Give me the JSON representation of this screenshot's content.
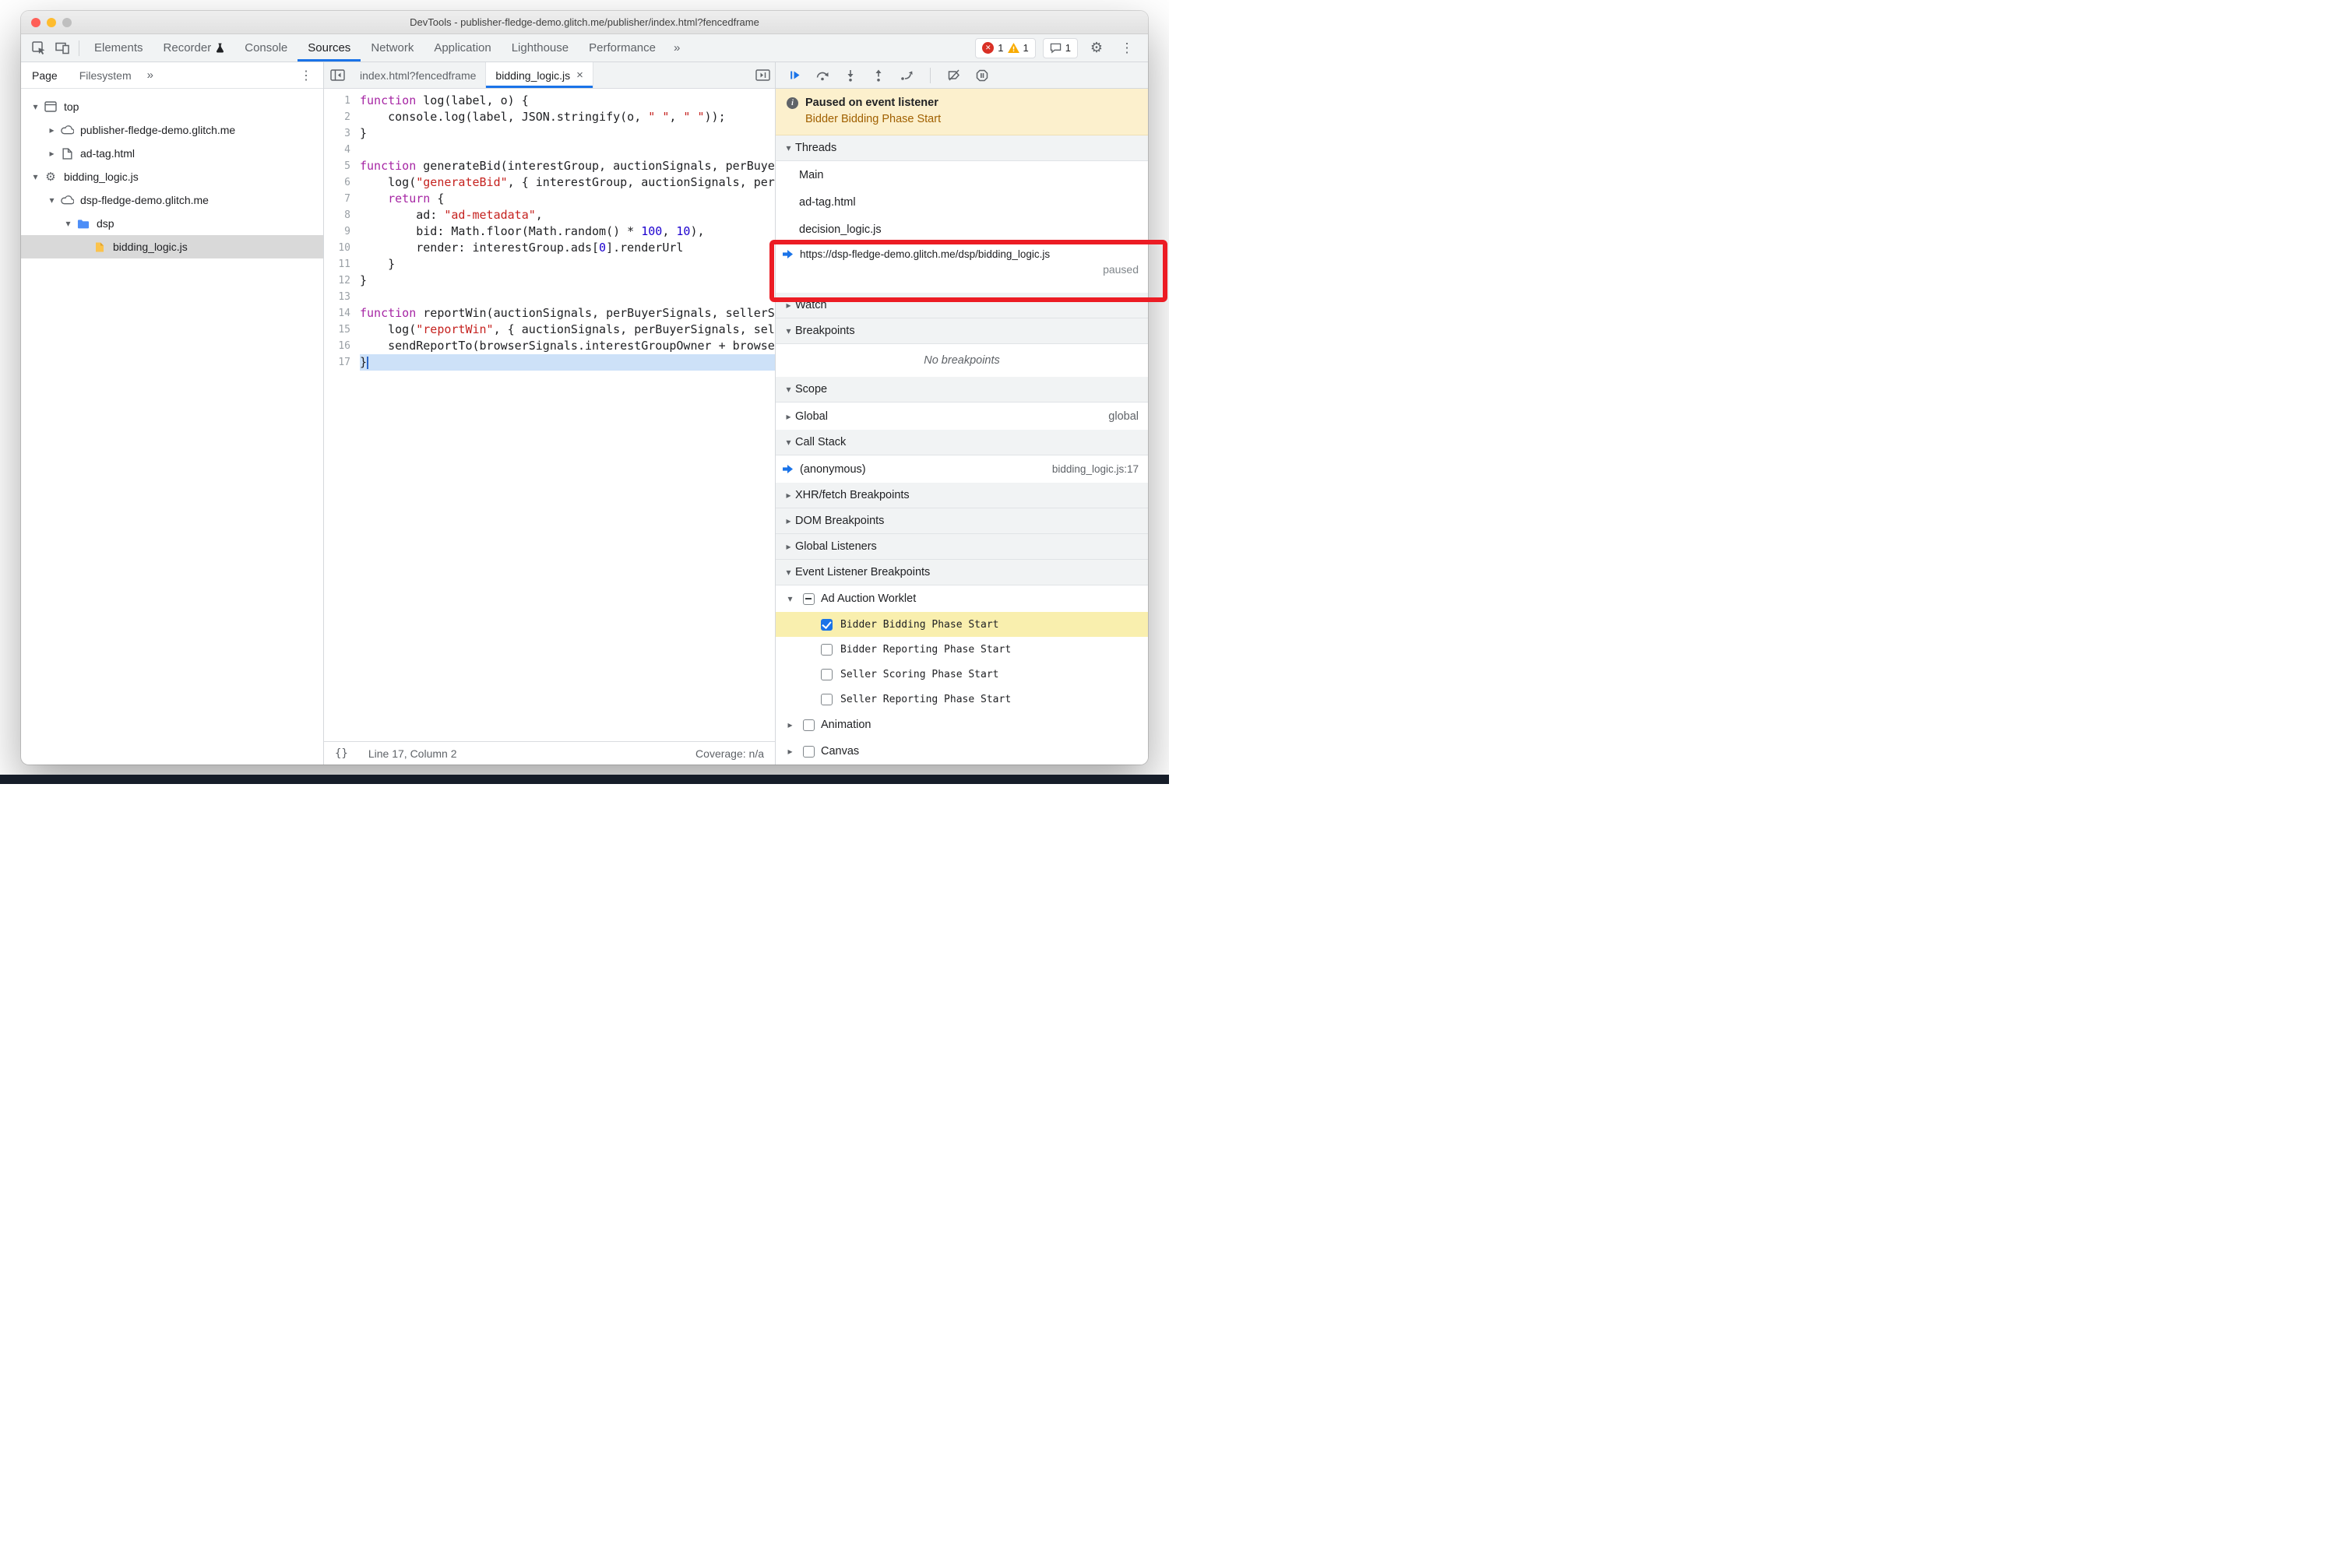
{
  "glyphs": {
    "expanded": "▾",
    "collapsed": "▸",
    "kebab": "⋮",
    "gear": "⚙",
    "close": "×",
    "pretty": "{}",
    "more": "»",
    "info": "i",
    "error": "✕"
  },
  "colors": {
    "accent": "#1a73e8",
    "annotation_red": "#ec1c24",
    "execution_line": "#cde1f8",
    "banner_bg": "#fcf0cd",
    "highlight_row": "#f9efae"
  },
  "window": {
    "title": "DevTools - publisher-fledge-demo.glitch.me/publisher/index.html?fencedframe"
  },
  "toolbar": {
    "tabs": [
      {
        "label": "Elements",
        "active": false
      },
      {
        "label": "Recorder",
        "active": false,
        "flask": true
      },
      {
        "label": "Console",
        "active": false
      },
      {
        "label": "Sources",
        "active": true
      },
      {
        "label": "Network",
        "active": false
      },
      {
        "label": "Application",
        "active": false
      },
      {
        "label": "Lighthouse",
        "active": false
      },
      {
        "label": "Performance",
        "active": false
      }
    ],
    "more_tabs": "»",
    "error_count": "1",
    "warning_count": "1",
    "message_count": "1"
  },
  "navigator": {
    "tabs": {
      "page": "Page",
      "filesystem": "Filesystem",
      "more": "»"
    },
    "tree": [
      {
        "label": "top",
        "icon": "frame",
        "arrow": "expanded",
        "indent": 0
      },
      {
        "label": "publisher-fledge-demo.glitch.me",
        "icon": "cloud",
        "arrow": "collapsed",
        "indent": 1
      },
      {
        "label": "ad-tag.html",
        "icon": "document",
        "arrow": "collapsed",
        "indent": 1
      },
      {
        "label": "bidding_logic.js",
        "icon": "worklet",
        "arrow": "expanded",
        "indent": 0
      },
      {
        "label": "dsp-fledge-demo.glitch.me",
        "icon": "cloud",
        "arrow": "expanded",
        "indent": 1
      },
      {
        "label": "dsp",
        "icon": "folder",
        "arrow": "expanded",
        "indent": 2
      },
      {
        "label": "bidding_logic.js",
        "icon": "file",
        "arrow": "none",
        "indent": 3,
        "selected": true
      }
    ]
  },
  "editor": {
    "tabs": [
      {
        "label": "index.html?fencedframe",
        "active": false
      },
      {
        "label": "bidding_logic.js",
        "active": true,
        "closable": true
      }
    ],
    "lines": [
      {
        "n": 1,
        "tokens": [
          [
            "kw",
            "function"
          ],
          [
            "pl",
            " log(label, o) {"
          ]
        ]
      },
      {
        "n": 2,
        "tokens": [
          [
            "pl",
            "    console.log(label, JSON.stringify(o, "
          ],
          [
            "str",
            "\" \""
          ],
          [
            "pl",
            ", "
          ],
          [
            "str",
            "\" \""
          ],
          [
            "pl",
            "));"
          ]
        ]
      },
      {
        "n": 3,
        "tokens": [
          [
            "pl",
            "}"
          ]
        ]
      },
      {
        "n": 4,
        "tokens": []
      },
      {
        "n": 5,
        "tokens": [
          [
            "kw",
            "function"
          ],
          [
            "pl",
            " generateBid(interestGroup, auctionSignals, perBuyerSignals, trustedBiddingSignals, browserSignals) {"
          ]
        ]
      },
      {
        "n": 6,
        "tokens": [
          [
            "pl",
            "    log("
          ],
          [
            "str",
            "\"generateBid\""
          ],
          [
            "pl",
            ", { interestGroup, auctionSignals, perBuyerSignals, trustedBiddingSignals });"
          ]
        ]
      },
      {
        "n": 7,
        "tokens": [
          [
            "pl",
            "    "
          ],
          [
            "kw",
            "return"
          ],
          [
            "pl",
            " {"
          ]
        ]
      },
      {
        "n": 8,
        "tokens": [
          [
            "pl",
            "        ad: "
          ],
          [
            "str",
            "\"ad-metadata\""
          ],
          [
            "pl",
            ","
          ]
        ]
      },
      {
        "n": 9,
        "tokens": [
          [
            "pl",
            "        bid: Math.floor(Math.random() * "
          ],
          [
            "num",
            "100"
          ],
          [
            "pl",
            ", "
          ],
          [
            "num",
            "10"
          ],
          [
            "pl",
            "),"
          ]
        ]
      },
      {
        "n": 10,
        "tokens": [
          [
            "pl",
            "        render: interestGroup.ads["
          ],
          [
            "num",
            "0"
          ],
          [
            "pl",
            "].renderUrl"
          ]
        ]
      },
      {
        "n": 11,
        "tokens": [
          [
            "pl",
            "    }"
          ]
        ]
      },
      {
        "n": 12,
        "tokens": [
          [
            "pl",
            "}"
          ]
        ]
      },
      {
        "n": 13,
        "tokens": []
      },
      {
        "n": 14,
        "tokens": [
          [
            "kw",
            "function"
          ],
          [
            "pl",
            " reportWin(auctionSignals, perBuyerSignals, sellerSignals, browserSignals) {"
          ]
        ]
      },
      {
        "n": 15,
        "tokens": [
          [
            "pl",
            "    log("
          ],
          [
            "str",
            "\"reportWin\""
          ],
          [
            "pl",
            ", { auctionSignals, perBuyerSignals, sellerSignals, browserSignals });"
          ]
        ]
      },
      {
        "n": 16,
        "tokens": [
          [
            "pl",
            "    sendReportTo(browserSignals.interestGroupOwner + browserSignals.topWindowHostname);"
          ]
        ]
      },
      {
        "n": 17,
        "tokens": [
          [
            "pl",
            "}"
          ]
        ],
        "hl": true
      }
    ],
    "status": {
      "line_col": "Line 17, Column 2",
      "coverage": "Coverage: n/a"
    }
  },
  "debugger": {
    "banner": {
      "title": "Paused on event listener",
      "subtitle": "Bidder Bidding Phase Start"
    },
    "threads": {
      "title": "Threads",
      "items": [
        {
          "label": "Main"
        },
        {
          "label": "ad-tag.html"
        },
        {
          "label": "decision_logic.js"
        },
        {
          "label": "https://dsp-fledge-demo.glitch.me/dsp/bidding_logic.js",
          "active": true,
          "status": "paused"
        }
      ]
    },
    "watch": {
      "title": "Watch"
    },
    "breakpoints": {
      "title": "Breakpoints",
      "empty": "No breakpoints"
    },
    "scope": {
      "title": "Scope",
      "rows": [
        {
          "label": "Global",
          "value": "global"
        }
      ]
    },
    "call_stack": {
      "title": "Call Stack",
      "frames": [
        {
          "label": "(anonymous)",
          "location": "bidding_logic.js:17",
          "active": true
        }
      ]
    },
    "xhr_breakpoints": {
      "title": "XHR/fetch Breakpoints"
    },
    "dom_breakpoints": {
      "title": "DOM Breakpoints"
    },
    "global_listeners": {
      "title": "Global Listeners"
    },
    "event_listener_breakpoints": {
      "title": "Event Listener Breakpoints",
      "categories": [
        {
          "label": "Ad Auction Worklet",
          "state": "indeterminate",
          "expanded": true,
          "events": [
            {
              "label": "Bidder Bidding Phase Start",
              "checked": true,
              "highlight": true
            },
            {
              "label": "Bidder Reporting Phase Start",
              "checked": false
            },
            {
              "label": "Seller Scoring Phase Start",
              "checked": false
            },
            {
              "label": "Seller Reporting Phase Start",
              "checked": false
            }
          ]
        },
        {
          "label": "Animation",
          "state": "unchecked",
          "expanded": false,
          "events": []
        },
        {
          "label": "Canvas",
          "state": "unchecked",
          "expanded": false,
          "events": []
        }
      ]
    }
  }
}
